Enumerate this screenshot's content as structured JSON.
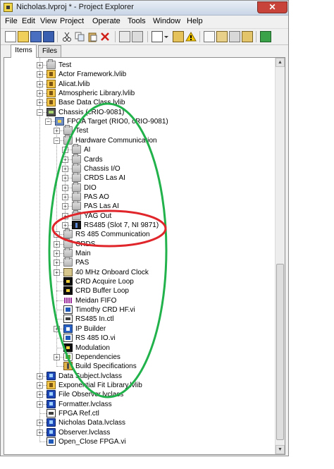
{
  "window": {
    "title": "Nicholas.lvproj * - Project Explorer",
    "close_glyph": "✕"
  },
  "menu": [
    "File",
    "Edit",
    "View",
    "Project",
    "Operate",
    "Tools",
    "Window",
    "Help"
  ],
  "toolbar": {
    "icons": [
      "new-icon",
      "open-icon",
      "save-all-icon",
      "save-icon",
      "cut-icon",
      "copy-icon",
      "paste-icon",
      "delete-icon",
      "build-icon",
      "deploy-icon",
      "view-toggle-icon",
      "dropdown-icon",
      "add-item-icon",
      "warning-icon",
      "tree-expand-icon",
      "filter-icon",
      "properties-icon",
      "help-icon",
      "diagram-icon"
    ]
  },
  "tabs": [
    {
      "label": "Items",
      "active": true
    },
    {
      "label": "Files",
      "active": false
    }
  ],
  "tree": [
    {
      "label": "Test",
      "icon": "folder",
      "level": 0,
      "expander": "+"
    },
    {
      "label": "Actor Framework.lvlib",
      "icon": "lvlib",
      "level": 0,
      "expander": "+"
    },
    {
      "label": "Alicat.lvlib",
      "icon": "lvlib",
      "level": 0,
      "expander": "+"
    },
    {
      "label": "Atmospheric Library.lvlib",
      "icon": "lvlib",
      "level": 0,
      "expander": "+"
    },
    {
      "label": "Base Data Class.lvlib",
      "icon": "lvlib",
      "level": 0,
      "expander": "+"
    },
    {
      "label": "Chassis (cRIO-9081)",
      "icon": "chassis",
      "level": 0,
      "expander": "−"
    },
    {
      "label": "FPGA Target (RIO0, cRIO-9081)",
      "icon": "fpga",
      "level": 1,
      "expander": "−"
    },
    {
      "label": "Test",
      "icon": "folder",
      "level": 2,
      "expander": "+"
    },
    {
      "label": "Hardware Communication",
      "icon": "folder",
      "level": 2,
      "expander": "−"
    },
    {
      "label": "AI",
      "icon": "folder",
      "level": 3,
      "expander": "+"
    },
    {
      "label": "Cards",
      "icon": "folder",
      "level": 3,
      "expander": "+"
    },
    {
      "label": "Chassis I/O",
      "icon": "folder",
      "level": 3,
      "expander": "+"
    },
    {
      "label": "CRDS Las AI",
      "icon": "folder",
      "level": 3,
      "expander": "+"
    },
    {
      "label": "DIO",
      "icon": "folder",
      "level": 3,
      "expander": "+"
    },
    {
      "label": "PAS AO",
      "icon": "folder",
      "level": 3,
      "expander": "+"
    },
    {
      "label": "PAS Las AI",
      "icon": "folder",
      "level": 3,
      "expander": "+"
    },
    {
      "label": "YAG Out",
      "icon": "folder",
      "level": 3,
      "expander": "+"
    },
    {
      "label": "RS485 (Slot 7, NI 9871)",
      "icon": "rs485",
      "level": 3,
      "expander": "+"
    },
    {
      "label": "RS 485 Communication",
      "icon": "folder",
      "level": 2,
      "expander": "+"
    },
    {
      "label": "CRDS",
      "icon": "folder",
      "level": 2,
      "expander": "+"
    },
    {
      "label": "Main",
      "icon": "folder",
      "level": 2,
      "expander": "+"
    },
    {
      "label": "PAS",
      "icon": "folder",
      "level": 2,
      "expander": "+"
    },
    {
      "label": "40 MHz Onboard Clock",
      "icon": "clock",
      "level": 2,
      "expander": "+"
    },
    {
      "label": "CRD Acquire Loop",
      "icon": "loop",
      "level": 2,
      "expander": ""
    },
    {
      "label": "CRD Buffer Loop",
      "icon": "loop",
      "level": 2,
      "expander": ""
    },
    {
      "label": "Meidan FIFO",
      "icon": "fifo",
      "level": 2,
      "expander": ""
    },
    {
      "label": "Timothy CRD HF.vi",
      "icon": "vi",
      "level": 2,
      "expander": ""
    },
    {
      "label": "RS485 In.ctl",
      "icon": "ctl",
      "level": 2,
      "expander": ""
    },
    {
      "label": "IP Builder",
      "icon": "ipb",
      "level": 2,
      "expander": "+"
    },
    {
      "label": "RS 485 IO.vi",
      "icon": "vi",
      "level": 2,
      "expander": ""
    },
    {
      "label": "Modulation",
      "icon": "loop",
      "level": 2,
      "expander": ""
    },
    {
      "label": "Dependencies",
      "icon": "deps",
      "level": 2,
      "expander": "+"
    },
    {
      "label": "Build Specifications",
      "icon": "build",
      "level": 2,
      "expander": ""
    },
    {
      "label": "Data Subject.lvclass",
      "icon": "lvclass",
      "level": 0,
      "expander": "+"
    },
    {
      "label": "Exponential Fit Library.lvlib",
      "icon": "lvlib",
      "level": 0,
      "expander": "+"
    },
    {
      "label": "File Observer.lvclass",
      "icon": "lvclass",
      "level": 0,
      "expander": "+"
    },
    {
      "label": "Formatter.lvclass",
      "icon": "lvclass",
      "level": 0,
      "expander": "+"
    },
    {
      "label": "FPGA Ref.ctl",
      "icon": "ctl",
      "level": 0,
      "expander": ""
    },
    {
      "label": "Nicholas Data.lvclass",
      "icon": "lvclass",
      "level": 0,
      "expander": "+"
    },
    {
      "label": "Observer.lvclass",
      "icon": "lvclass",
      "level": 0,
      "expander": "+"
    },
    {
      "label": "Open_Close FPGA.vi",
      "icon": "vi",
      "level": 0,
      "expander": ""
    }
  ],
  "colors": {
    "green_annotation": "#22b24c",
    "red_annotation": "#e0262b"
  }
}
